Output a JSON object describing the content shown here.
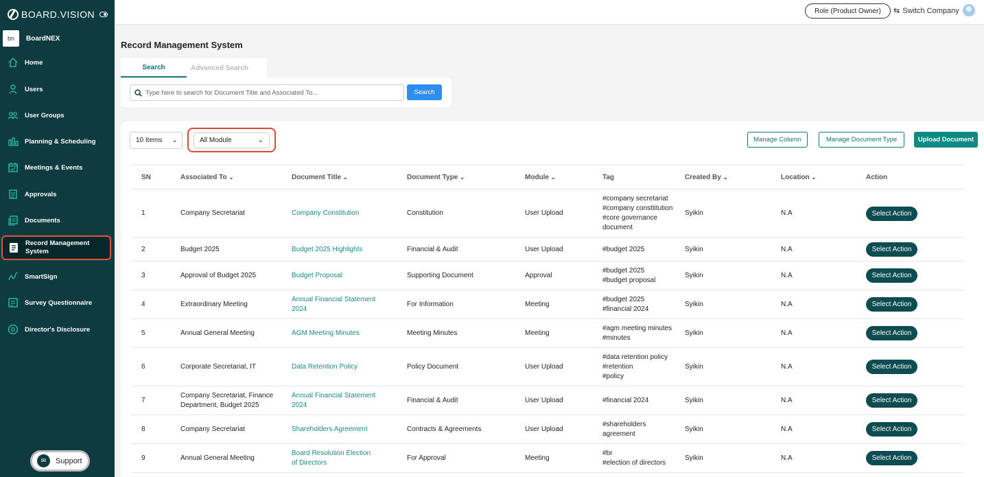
{
  "brand": {
    "name": "BOARD.VISION"
  },
  "org": {
    "logo_text": "bn",
    "name": "BoardNEX"
  },
  "sidebar": {
    "items": [
      {
        "label": "Home",
        "icon": "home-icon"
      },
      {
        "label": "Users",
        "icon": "user-icon"
      },
      {
        "label": "User Groups",
        "icon": "users-icon"
      },
      {
        "label": "Planning & Scheduling",
        "icon": "chart-icon"
      },
      {
        "label": "Meetings & Events",
        "icon": "calendar-icon"
      },
      {
        "label": "Approvals",
        "icon": "approval-icon"
      },
      {
        "label": "Documents",
        "icon": "documents-icon"
      },
      {
        "label": "Record Management System",
        "icon": "record-icon",
        "active": true
      },
      {
        "label": "SmartSign",
        "icon": "signature-icon"
      },
      {
        "label": "Survey Questionnaire",
        "icon": "survey-icon"
      },
      {
        "label": "Director's Disclosure",
        "icon": "disclosure-icon"
      }
    ],
    "support_label": "Support"
  },
  "topbar": {
    "role_label": "Role (Product Owner)",
    "switch_label": "Switch Company"
  },
  "main": {
    "title": "Record Management System",
    "tabs": [
      {
        "label": "Search",
        "active": true
      },
      {
        "label": "Advanced Search",
        "active": false
      }
    ],
    "search": {
      "placeholder": "Type here to search for Document Title and Associated To...",
      "button_label": "Search"
    },
    "toolbar": {
      "items_select": "10 Items",
      "module_select": "All Module",
      "manage_column": "Manage Column",
      "manage_doc_type": "Manage Document Type",
      "upload_document": "Upload Document"
    },
    "table": {
      "headers": [
        "SN",
        "Associated To",
        "Document Title",
        "Document Type",
        "Module",
        "Tag",
        "Created By",
        "Location",
        "Action"
      ],
      "rows": [
        {
          "sn": "1",
          "assoc": "Company Secretariat",
          "title": "Company Constitution",
          "type": "Constitution",
          "module": "User Upload",
          "tag": "#company secretariat\n#company consttitution\n#core governance\ndocument",
          "by": "Syikin",
          "loc": "N.A",
          "action": "Select Action"
        },
        {
          "sn": "2",
          "assoc": "Budget 2025",
          "title": "Budget 2025 Highlights",
          "type": "Financial & Audit",
          "module": "User Upload",
          "tag": "#budget 2025",
          "by": "Syikin",
          "loc": "N.A",
          "action": "Select Action"
        },
        {
          "sn": "3",
          "assoc": "Approval of Budget 2025",
          "title": "Budget Proposal",
          "type": "Supporting Document",
          "module": "Approval",
          "tag": "#budget 2025\n#budget proposal",
          "by": "Syikin",
          "loc": "N.A",
          "action": "Select Action"
        },
        {
          "sn": "4",
          "assoc": "Extraordinary Meeting",
          "title": "Annual Financial Statement\n2024",
          "type": "For Information",
          "module": "Meeting",
          "tag": "#budget 2025\n#financial 2024",
          "by": "Syikin",
          "loc": "N.A",
          "action": "Select Action"
        },
        {
          "sn": "5",
          "assoc": "Annual General Meeting",
          "title": "AGM Meeting Minutes",
          "type": "Meeting Minutes",
          "module": "Meeting",
          "tag": "#agm meeting minutes\n#minutes",
          "by": "Syikin",
          "loc": "N.A",
          "action": "Select Action"
        },
        {
          "sn": "6",
          "assoc": "Corporate Secretariat, IT",
          "title": "Data Retention Policy",
          "type": "Policy Document",
          "module": "User Upload",
          "tag": "#data retention policy\n#retention\n#policy",
          "by": "Syikin",
          "loc": "N.A",
          "action": "Select Action"
        },
        {
          "sn": "7",
          "assoc": "Company Secretariat, Finance\nDepartment, Budget 2025",
          "title": "Annual Financial Statement\n2024",
          "type": "Financial & Audit",
          "module": "User Upload",
          "tag": "#financial 2024",
          "by": "Syikin",
          "loc": "N.A",
          "action": "Select Action"
        },
        {
          "sn": "8",
          "assoc": "Company Secretariat",
          "title": "Shareholders Agreement",
          "type": "Contracts & Agreements",
          "module": "User Upload",
          "tag": "#shareholders\nagreement",
          "by": "Syikin",
          "loc": "N.A",
          "action": "Select Action"
        },
        {
          "sn": "9",
          "assoc": "Annual General Meeting",
          "title": "Board Resolution Election\nof Directors",
          "type": "For Approval",
          "module": "Meeting",
          "tag": "#br\n#election of directors",
          "by": "Syikin",
          "loc": "N.A",
          "action": "Select Action"
        }
      ]
    }
  },
  "colors": {
    "sidebar": "#0d3b3f",
    "accent": "#0d7a77",
    "highlight": "#d9473a",
    "primary_button": "#2e8ef0"
  }
}
